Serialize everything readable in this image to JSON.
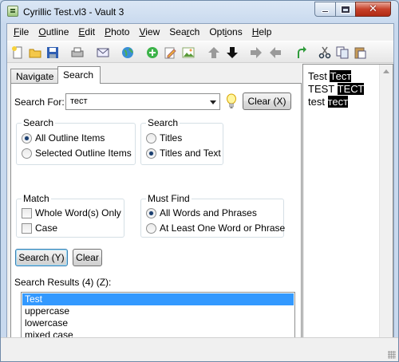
{
  "window": {
    "title": "Cyrillic Test.vl3 - Vault 3"
  },
  "menu": [
    {
      "key": "F",
      "rest": "ile"
    },
    {
      "key": "O",
      "rest": "utline"
    },
    {
      "key": "E",
      "rest": "dit"
    },
    {
      "key": "P",
      "rest": "hoto"
    },
    {
      "key": "V",
      "rest": "iew"
    },
    {
      "pre": "Sea",
      "key": "r",
      "rest": "ch"
    },
    {
      "pre": "Opt",
      "key": "i",
      "rest": "ons"
    },
    {
      "key": "H",
      "rest": "elp"
    }
  ],
  "toolbar_icons": [
    "new-icon",
    "open-folder-icon",
    "save-icon",
    "print-icon",
    "email-icon",
    "globe-icon",
    "add-icon",
    "edit-icon",
    "photo-icon",
    "move-up-icon",
    "move-down-icon",
    "move-right-icon",
    "move-left-icon",
    "undo-icon",
    "cut-icon",
    "copy-icon",
    "paste-icon"
  ],
  "tabs": {
    "navigate": "Navigate",
    "search": "Search"
  },
  "search": {
    "label": "Search For:",
    "value": "тест",
    "clear_label": "Clear (X)",
    "scope_group": "Search",
    "scope_all": "All Outline Items",
    "scope_selected": "Selected Outline Items",
    "in_group": "Search",
    "in_titles": "Titles",
    "in_titles_text": "Titles and Text",
    "match_group": "Match",
    "match_whole": "Whole Word(s) Only",
    "match_case": "Case",
    "must_group": "Must Find",
    "must_all": "All Words and Phrases",
    "must_any": "At Least One Word or Phrase",
    "search_button": "Search (Y)",
    "clear_button": "Clear",
    "results_label": "Search Results (4) (Z):",
    "results": [
      "Test",
      "uppercase",
      "lowercase",
      "mixed case"
    ]
  },
  "preview": {
    "lines": [
      {
        "plain": "Test",
        "hit": "Тест"
      },
      {
        "plain": "TEST",
        "hit": "ТЕСТ"
      },
      {
        "plain": "test",
        "hit": "тест"
      }
    ]
  },
  "colors": {
    "selection": "#3399ff",
    "highlight": "#000000"
  }
}
